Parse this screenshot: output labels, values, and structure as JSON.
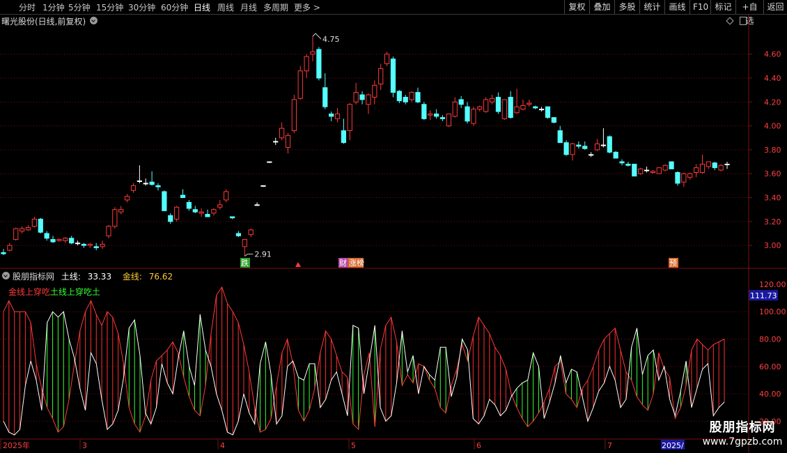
{
  "toolbar": {
    "periods": [
      "分时",
      "1分钟",
      "5分钟",
      "15分钟",
      "30分钟",
      "60分钟",
      "日线",
      "周线",
      "月线",
      "多周期",
      "更多"
    ],
    "active_period": "日线",
    "right_buttons": [
      "复权",
      "叠加",
      "多股",
      "统计",
      "画线",
      "F10",
      "标记",
      "+自选",
      "返回"
    ]
  },
  "main_chart": {
    "title": "曙光股份(日线,前复权)",
    "y_ticks": [
      "4.60",
      "4.40",
      "4.20",
      "4.00",
      "3.80",
      "3.60",
      "3.40",
      "3.20",
      "3.00"
    ],
    "high_label": "4.75",
    "low_label": "2.91",
    "badges": [
      {
        "text": "跌",
        "color": "#2fa12f"
      },
      {
        "text": "财",
        "color": "#b84aa8"
      },
      {
        "text": "涨榜",
        "color": "#d86a2a"
      },
      {
        "text": "预",
        "color": "#d86a2a"
      }
    ],
    "colors": {
      "up": "#ff3a3a",
      "down": "#54ffff",
      "flat": "#ffffff",
      "grid": "#7a1010"
    }
  },
  "indicator": {
    "name": "股朋指标网",
    "earth_label": "土线:",
    "earth_value": "33.33",
    "gold_label": "金线:",
    "gold_value": "76.62",
    "signal_text_1": "金线上穿吃土",
    "signal_text_2": "土线上穿吃土",
    "current_value": "111.73",
    "y_ticks": [
      "100.00",
      "80.00",
      "60.00",
      "40.00",
      "20.00"
    ],
    "top_tick": "120.00"
  },
  "time_axis": {
    "labels": [
      "2025年",
      "3",
      "4",
      "5",
      "6",
      "7",
      "2025/"
    ]
  },
  "watermark": {
    "name": "股朋指标网",
    "url": "www.7gpzb.com"
  },
  "chart_data": [
    {
      "type": "candlestick",
      "title": "曙光股份(日线,前复权)",
      "ylim": [
        2.82,
        4.82
      ],
      "candles": [
        [
          2.94,
          2.97,
          2.92,
          2.93
        ],
        [
          2.96,
          3.02,
          2.95,
          3.0
        ],
        [
          3.05,
          3.15,
          3.04,
          3.14
        ],
        [
          3.12,
          3.16,
          3.1,
          3.14
        ],
        [
          3.13,
          3.17,
          3.12,
          3.15
        ],
        [
          3.16,
          3.24,
          3.15,
          3.22
        ],
        [
          3.22,
          3.23,
          3.1,
          3.11
        ],
        [
          3.1,
          3.12,
          3.04,
          3.06
        ],
        [
          3.05,
          3.08,
          3.02,
          3.03
        ],
        [
          3.04,
          3.06,
          3.03,
          3.05
        ],
        [
          3.04,
          3.07,
          3.02,
          3.06
        ],
        [
          3.06,
          3.08,
          3.01,
          3.02
        ],
        [
          3.02,
          3.04,
          3.0,
          3.02
        ],
        [
          3.01,
          3.02,
          2.98,
          3.0
        ],
        [
          3.0,
          3.02,
          2.98,
          3.01
        ],
        [
          2.99,
          3.02,
          2.96,
          2.98
        ],
        [
          2.99,
          3.04,
          2.97,
          3.01
        ],
        [
          3.08,
          3.17,
          3.06,
          3.16
        ],
        [
          3.16,
          3.32,
          3.14,
          3.3
        ],
        [
          3.28,
          3.33,
          3.26,
          3.3
        ],
        [
          3.38,
          3.43,
          3.36,
          3.41
        ],
        [
          3.46,
          3.52,
          3.44,
          3.5
        ],
        [
          3.54,
          3.67,
          3.52,
          3.54
        ],
        [
          3.52,
          3.56,
          3.5,
          3.52
        ],
        [
          3.53,
          3.62,
          3.5,
          3.51
        ],
        [
          3.5,
          3.52,
          3.46,
          3.49
        ],
        [
          3.45,
          3.46,
          3.29,
          3.29
        ],
        [
          3.25,
          3.27,
          3.18,
          3.2
        ],
        [
          3.22,
          3.33,
          3.2,
          3.32
        ],
        [
          3.42,
          3.47,
          3.4,
          3.4
        ],
        [
          3.36,
          3.38,
          3.29,
          3.31
        ],
        [
          3.3,
          3.33,
          3.27,
          3.28
        ],
        [
          3.27,
          3.31,
          3.24,
          3.28
        ],
        [
          3.26,
          3.3,
          3.24,
          3.24
        ],
        [
          3.27,
          3.31,
          3.25,
          3.3
        ],
        [
          3.32,
          3.38,
          3.3,
          3.34
        ],
        [
          3.38,
          3.47,
          3.36,
          3.45
        ],
        [
          3.24,
          3.24,
          3.22,
          3.23
        ],
        [
          3.1,
          3.12,
          3.07,
          3.08
        ],
        [
          2.99,
          3.01,
          2.91,
          3.05
        ],
        [
          3.09,
          3.14,
          3.07,
          3.13
        ],
        [
          3.34,
          3.36,
          3.33,
          3.34
        ],
        [
          3.5,
          3.5,
          3.49,
          3.5
        ],
        [
          3.7,
          3.7,
          3.69,
          3.7
        ],
        [
          3.87,
          3.9,
          3.84,
          3.87
        ],
        [
          3.9,
          4.03,
          3.88,
          3.98
        ],
        [
          3.82,
          3.94,
          3.77,
          3.92
        ],
        [
          3.96,
          4.26,
          3.94,
          4.22
        ],
        [
          4.23,
          4.5,
          4.22,
          4.46
        ],
        [
          4.46,
          4.6,
          4.4,
          4.58
        ],
        [
          4.6,
          4.75,
          4.54,
          4.62
        ],
        [
          4.64,
          4.66,
          4.38,
          4.4
        ],
        [
          4.32,
          4.44,
          4.14,
          4.16
        ],
        [
          4.1,
          4.12,
          4.04,
          4.08
        ],
        [
          4.06,
          4.15,
          4.03,
          4.1
        ],
        [
          3.96,
          4.06,
          3.85,
          3.86
        ],
        [
          3.96,
          4.19,
          3.88,
          4.18
        ],
        [
          4.2,
          4.36,
          4.18,
          4.28
        ],
        [
          4.26,
          4.29,
          4.18,
          4.22
        ],
        [
          4.18,
          4.27,
          4.1,
          4.26
        ],
        [
          4.24,
          4.38,
          4.18,
          4.34
        ],
        [
          4.35,
          4.52,
          4.3,
          4.48
        ],
        [
          4.52,
          4.62,
          4.5,
          4.6
        ],
        [
          4.56,
          4.58,
          4.24,
          4.28
        ],
        [
          4.29,
          4.3,
          4.19,
          4.21
        ],
        [
          4.24,
          4.26,
          4.18,
          4.2
        ],
        [
          4.22,
          4.29,
          4.2,
          4.28
        ],
        [
          4.28,
          4.32,
          4.19,
          4.2
        ],
        [
          4.18,
          4.2,
          4.05,
          4.06
        ],
        [
          4.09,
          4.13,
          4.05,
          4.1
        ],
        [
          4.1,
          4.14,
          4.06,
          4.08
        ],
        [
          4.07,
          4.09,
          4.04,
          4.06
        ],
        [
          4.0,
          4.1,
          3.99,
          4.1
        ],
        [
          4.08,
          4.24,
          4.07,
          4.2
        ],
        [
          4.22,
          4.25,
          4.15,
          4.18
        ],
        [
          4.16,
          4.2,
          4.02,
          4.04
        ],
        [
          4.02,
          4.16,
          4.0,
          4.14
        ],
        [
          4.14,
          4.17,
          4.12,
          4.16
        ],
        [
          4.12,
          4.24,
          4.11,
          4.22
        ],
        [
          4.2,
          4.26,
          4.18,
          4.23
        ],
        [
          4.24,
          4.28,
          4.1,
          4.12
        ],
        [
          4.06,
          4.22,
          4.05,
          4.22
        ],
        [
          4.24,
          4.29,
          4.06,
          4.07
        ],
        [
          4.11,
          4.31,
          4.1,
          4.16
        ],
        [
          4.14,
          4.22,
          4.13,
          4.17
        ],
        [
          4.18,
          4.22,
          4.16,
          4.19
        ],
        [
          4.16,
          4.17,
          4.14,
          4.15
        ],
        [
          4.14,
          4.16,
          4.12,
          4.14
        ],
        [
          4.16,
          4.16,
          4.06,
          4.07
        ],
        [
          4.07,
          4.07,
          4.02,
          4.03
        ],
        [
          3.96,
          4.0,
          3.86,
          3.86
        ],
        [
          3.86,
          3.88,
          3.75,
          3.76
        ],
        [
          3.76,
          3.86,
          3.71,
          3.85
        ],
        [
          3.84,
          3.87,
          3.81,
          3.83
        ],
        [
          3.83,
          3.87,
          3.8,
          3.81
        ],
        [
          3.76,
          3.78,
          3.74,
          3.76
        ],
        [
          3.8,
          3.89,
          3.79,
          3.85
        ],
        [
          3.84,
          3.98,
          3.82,
          3.84
        ],
        [
          3.91,
          3.92,
          3.77,
          3.78
        ],
        [
          3.78,
          3.79,
          3.73,
          3.73
        ],
        [
          3.7,
          3.72,
          3.67,
          3.69
        ],
        [
          3.68,
          3.7,
          3.66,
          3.67
        ],
        [
          3.68,
          3.68,
          3.58,
          3.58
        ],
        [
          3.6,
          3.65,
          3.59,
          3.64
        ],
        [
          3.63,
          3.66,
          3.61,
          3.63
        ],
        [
          3.61,
          3.63,
          3.6,
          3.62
        ],
        [
          3.6,
          3.65,
          3.6,
          3.65
        ],
        [
          3.63,
          3.68,
          3.62,
          3.67
        ],
        [
          3.7,
          3.7,
          3.64,
          3.64
        ],
        [
          3.61,
          3.62,
          3.5,
          3.52
        ],
        [
          3.53,
          3.61,
          3.49,
          3.6
        ],
        [
          3.57,
          3.61,
          3.55,
          3.6
        ],
        [
          3.61,
          3.68,
          3.57,
          3.65
        ],
        [
          3.61,
          3.76,
          3.6,
          3.68
        ],
        [
          3.66,
          3.7,
          3.64,
          3.7
        ],
        [
          3.69,
          3.7,
          3.63,
          3.65
        ],
        [
          3.63,
          3.68,
          3.62,
          3.67
        ],
        [
          3.68,
          3.7,
          3.64,
          3.68
        ]
      ]
    },
    {
      "type": "line",
      "title": "股朋指标网",
      "ylim": [
        8,
        122
      ],
      "series": [
        {
          "name": "土线",
          "color": "#ffffff",
          "values": [
            20,
            12,
            10,
            14,
            46,
            64,
            50,
            28,
            92,
            100,
            96,
            100,
            80,
            66,
            44,
            28,
            70,
            62,
            36,
            14,
            18,
            28,
            52,
            88,
            94,
            68,
            26,
            18,
            30,
            62,
            48,
            40,
            66,
            86,
            60,
            46,
            98,
            72,
            60,
            40,
            28,
            12,
            10,
            20,
            40,
            26,
            18,
            62,
            78,
            54,
            18,
            24,
            60,
            64,
            52,
            50,
            62,
            62,
            30,
            36,
            50,
            56,
            40,
            24,
            90,
            88,
            40,
            64,
            90,
            30,
            20,
            24,
            48,
            86,
            56,
            68,
            40,
            60,
            54,
            50,
            74,
            74,
            38,
            52,
            80,
            72,
            22,
            18,
            24,
            36,
            32,
            24,
            28,
            38,
            44,
            48,
            50,
            70,
            60,
            22,
            34,
            48,
            68,
            48,
            58,
            56,
            38,
            20,
            30,
            42,
            48,
            60,
            50,
            30,
            36,
            74,
            88,
            54,
            68,
            72,
            50,
            60,
            36,
            24,
            42,
            64,
            30,
            44,
            58,
            62,
            24,
            30,
            34
          ]
        },
        {
          "name": "金线",
          "color": "#ff3a3a",
          "values": [
            100,
            108,
            100,
            100,
            100,
            92,
            62,
            44,
            30,
            22,
            12,
            16,
            36,
            62,
            86,
            100,
            108,
            98,
            90,
            100,
            96,
            84,
            62,
            30,
            18,
            12,
            24,
            50,
            64,
            68,
            72,
            78,
            70,
            52,
            38,
            28,
            24,
            46,
            84,
            112,
            118,
            106,
            100,
            92,
            76,
            56,
            30,
            12,
            14,
            22,
            46,
            70,
            80,
            62,
            28,
            20,
            28,
            44,
            70,
            86,
            80,
            68,
            56,
            52,
            18,
            14,
            54,
            70,
            16,
            72,
            90,
            96,
            78,
            46,
            54,
            48,
            62,
            60,
            50,
            44,
            30,
            26,
            46,
            58,
            76,
            64,
            82,
            96,
            90,
            84,
            74,
            68,
            58,
            40,
            30,
            22,
            16,
            20,
            26,
            34,
            44,
            60,
            64,
            40,
            36,
            30,
            44,
            50,
            60,
            72,
            80,
            84,
            88,
            72,
            56,
            50,
            38,
            32,
            28,
            40,
            70,
            58,
            52,
            22,
            30,
            46,
            72,
            80,
            76,
            72,
            76,
            78,
            80
          ]
        }
      ]
    }
  ]
}
